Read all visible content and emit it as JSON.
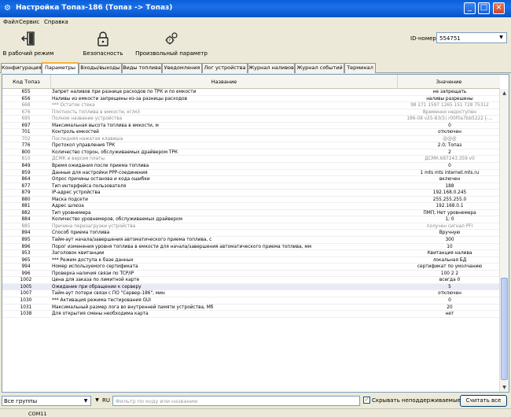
{
  "window": {
    "title": "Настройка Топаз-186 (Топаз -> Топаз)",
    "controls": [
      "_",
      "□",
      "×"
    ]
  },
  "menu": [
    "Файл",
    "Сервис",
    "Справка"
  ],
  "toolbar": {
    "buttons": [
      {
        "label": "В рабочий режим",
        "icon": "exit-door-icon"
      },
      {
        "label": "Безопасность",
        "icon": "padlock-icon"
      },
      {
        "label": "Произвольный параметр",
        "icon": "gears-question-icon"
      }
    ],
    "id_label": "ID-номер",
    "id_value": "554751"
  },
  "tabs": [
    "Конфигурация",
    "Параметры",
    "Входы/выходы",
    "Виды топлива",
    "Уведомления",
    "Лог устройства",
    "Журнал наливов",
    "Журнал событий",
    "Терминал"
  ],
  "active_tab": "Параметры",
  "grid": {
    "headers": {
      "code": "Код Топаз",
      "name": "Название",
      "value": "Значение"
    },
    "rows": [
      {
        "code": "655",
        "name": "Запрет наливов при разнице расходов по ТРК и по емкости",
        "value": "не запрещать",
        "disabled": false
      },
      {
        "code": "656",
        "name": "Наливы из емкости запрещены из-за разницы расходов",
        "value": "наливы разрешены",
        "disabled": false
      },
      {
        "code": "668",
        "name": "*** Остаток стека",
        "value": "98 271 1597 1265 151 728 75312",
        "disabled": true
      },
      {
        "code": "676",
        "name": "Плотность топлива в емкости, кг/м3",
        "value": "Временно недоступен",
        "disabled": true
      },
      {
        "code": "695",
        "name": "Полное название устройства",
        "value": "186-08 v25-83(5) r00f0a7bb5222 [-...",
        "disabled": true
      },
      {
        "code": "697",
        "name": "Максимальная высота топлива в емкости, м",
        "value": "0",
        "disabled": false
      },
      {
        "code": "701",
        "name": "Контроль емкостей",
        "value": "отключен",
        "disabled": false
      },
      {
        "code": "702",
        "name": "Последняя нажатая клавиша",
        "value": "@@@",
        "disabled": true
      },
      {
        "code": "776",
        "name": "Протокол управления ТРК",
        "value": "2.0; Топаз",
        "disabled": false
      },
      {
        "code": "800",
        "name": "Количество сторон, обслуживаемых драйвером ТРК",
        "value": "2",
        "disabled": false
      },
      {
        "code": "810",
        "name": "ДСМК и версия платы",
        "value": "ДСМК.687243.359 v0",
        "disabled": true
      },
      {
        "code": "849",
        "name": "Время ожидания после приема топлива",
        "value": "0",
        "disabled": false
      },
      {
        "code": "859",
        "name": "Данные для настройки PPP-соединения",
        "value": "1 mts mts internet.mts.ru",
        "disabled": false
      },
      {
        "code": "864",
        "name": "Опрос причины останова и кода ошибки",
        "value": "включен",
        "disabled": false
      },
      {
        "code": "877",
        "name": "Тип интерфейса пользователя",
        "value": "188",
        "disabled": false
      },
      {
        "code": "879",
        "name": "IP-адрес устройства",
        "value": "192.168.0.245",
        "disabled": false
      },
      {
        "code": "880",
        "name": "Маска подсети",
        "value": "255.255.255.0",
        "disabled": false
      },
      {
        "code": "881",
        "name": "Адрес шлюза",
        "value": "192.168.0.1",
        "disabled": false
      },
      {
        "code": "882",
        "name": "Тип уровнемера",
        "value": "ПМП; Нет уровнемера",
        "disabled": false
      },
      {
        "code": "884",
        "name": "Количество уровнемеров, обслуживаемых драйвером",
        "value": "1; 0",
        "disabled": false
      },
      {
        "code": "885",
        "name": "Причина перезагрузки устройства",
        "value": "получен сигнал PFI",
        "disabled": true
      },
      {
        "code": "894",
        "name": "Способ приема топлива",
        "value": "Вручную",
        "disabled": false
      },
      {
        "code": "895",
        "name": "Тайм-аут начала/завершения автоматического приема топлива, с",
        "value": "300",
        "disabled": false
      },
      {
        "code": "896",
        "name": "Порог изменения уровня топлива в емкости для начала/завершения автоматического приема топлива, мм",
        "value": "10",
        "disabled": false
      },
      {
        "code": "953",
        "name": "Заголовок квитанции",
        "value": "Квитанция налива",
        "disabled": false
      },
      {
        "code": "965",
        "name": "*** Режим доступа к базе данных",
        "value": "локальная БД",
        "disabled": false
      },
      {
        "code": "994",
        "name": "Номер используемого сертификата",
        "value": "сертификат по умолчанию",
        "disabled": false
      },
      {
        "code": "996",
        "name": "Проверка наличия связи по TCP/IP",
        "value": "100 2 2",
        "disabled": false
      },
      {
        "code": "1002",
        "name": "Цена для заказа по лимитной карте",
        "value": "всегда 0",
        "disabled": false
      },
      {
        "code": "1005",
        "name": "Ожидание при обращении к серверу",
        "value": "5",
        "disabled": false
      },
      {
        "code": "1007",
        "name": "Тайм-аут потери связи с ПО \"Сервер-186\", мин",
        "value": "отключен",
        "disabled": false
      },
      {
        "code": "1030",
        "name": "*** Активация режима тестирования GUI",
        "value": "0",
        "disabled": false
      },
      {
        "code": "1031",
        "name": "Максимальный размер лога во внутренней памяти устройства, Мб",
        "value": "20",
        "disabled": false
      },
      {
        "code": "1038",
        "name": "Для открытия смены необходима карта",
        "value": "нет",
        "disabled": false
      }
    ],
    "selected_code": "1005"
  },
  "bottom": {
    "group_select": "Все группы",
    "ru_label": "RU",
    "filter_placeholder": "Фильтр по коду или названию",
    "hide_unsupported_label": "Скрывать неподдерживаемые",
    "hide_unsupported_checked": true,
    "count_button": "Считать все"
  },
  "status": {
    "port": "COM11"
  }
}
